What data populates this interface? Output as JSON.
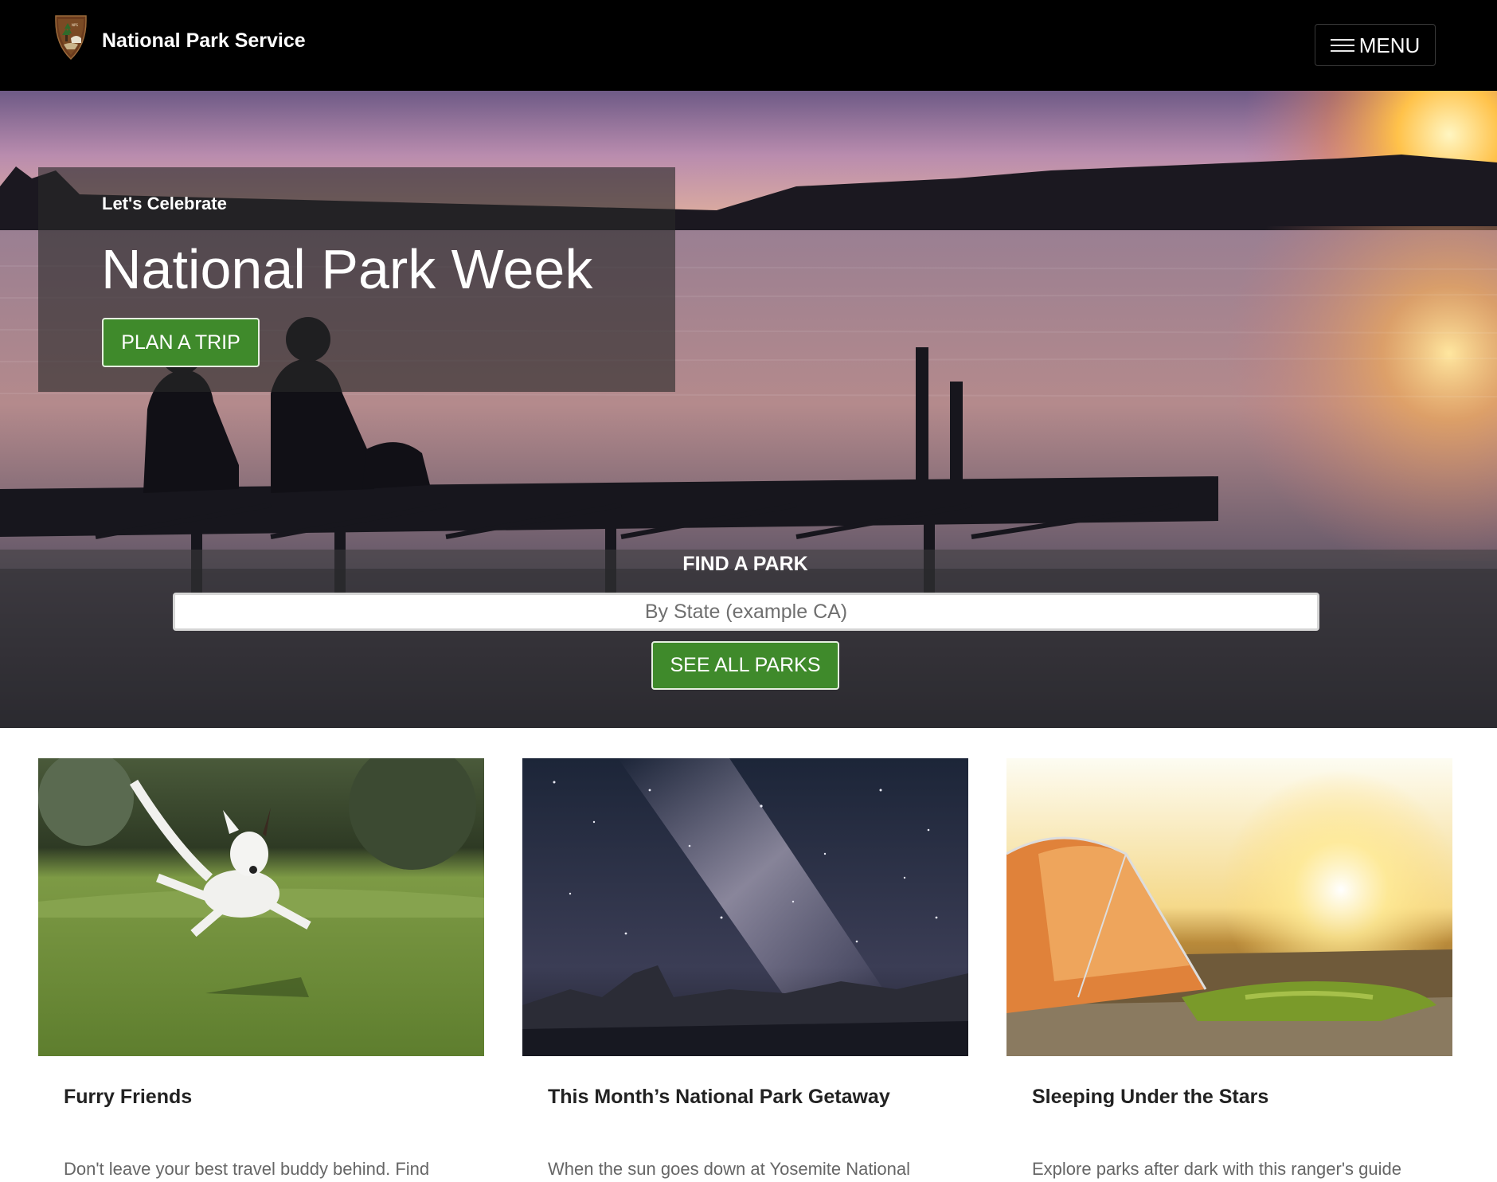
{
  "header": {
    "site_title": "National Park Service",
    "logo_icon": "arrowhead-icon",
    "menu_label": "MENU",
    "menu_icon": "hamburger-icon"
  },
  "hero": {
    "eyebrow": "Let's Celebrate",
    "headline": "National Park Week",
    "plan_button": "PLAN A TRIP"
  },
  "find_park": {
    "title": "FIND A PARK",
    "input_placeholder": "By State (example CA)",
    "input_value": "",
    "see_all_button": "SEE ALL PARKS"
  },
  "cards": [
    {
      "title": "Furry Friends",
      "description": "Don't leave your best travel buddy behind. Find",
      "image": "dog-leaping-on-grass"
    },
    {
      "title": "This Month’s National Park Getaway",
      "description": "When the sun goes down at Yosemite National",
      "image": "milky-way-over-mountains"
    },
    {
      "title": "Sleeping Under the Stars",
      "description": "Explore parks after dark with this ranger's guide",
      "image": "tent-at-sunset"
    }
  ],
  "colors": {
    "topbar": "#000000",
    "button_green": "#3f8a2b",
    "text_dark": "#222222",
    "text_muted": "#666666"
  }
}
